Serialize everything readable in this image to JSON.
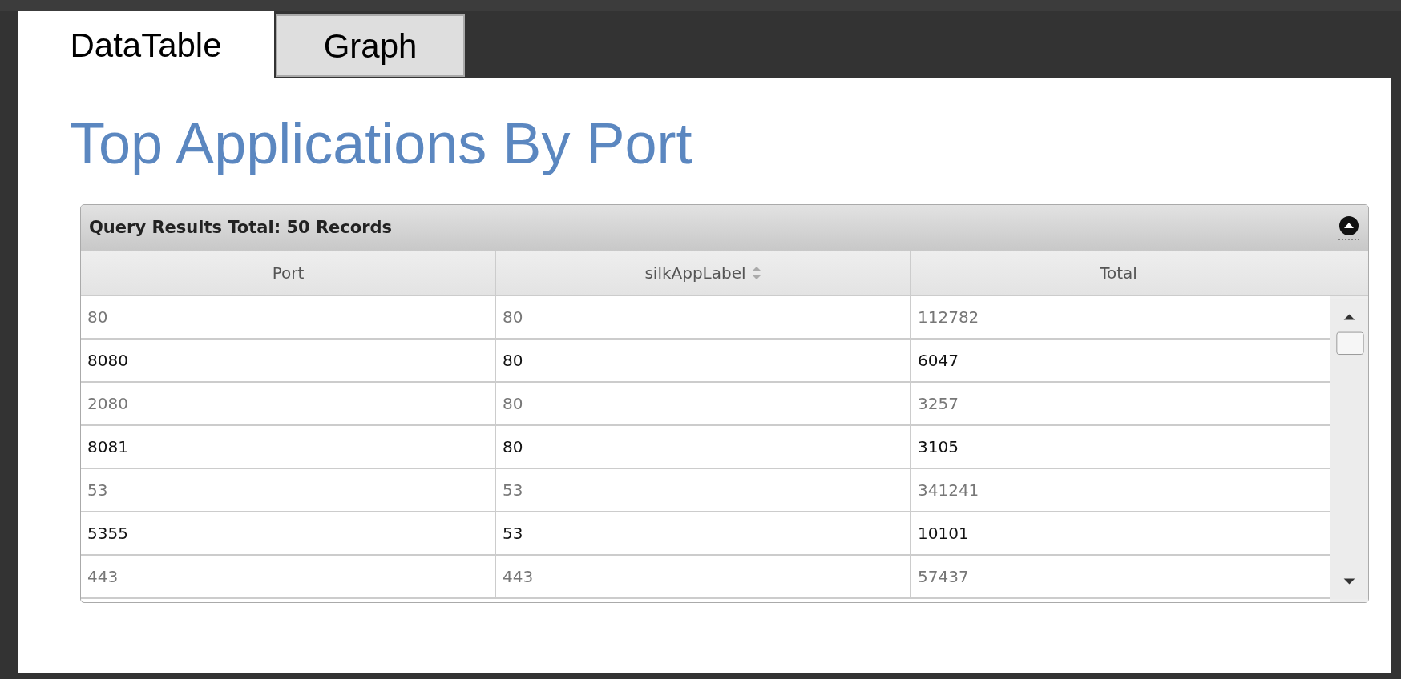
{
  "tabs": [
    {
      "label": "DataTable",
      "selected": true
    },
    {
      "label": "Graph",
      "selected": false
    }
  ],
  "title": "Top Applications By Port",
  "grid": {
    "caption": "Query Results Total: 50 Records",
    "columns": [
      {
        "label": "Port",
        "sortable": false
      },
      {
        "label": "silkAppLabel",
        "sortable": true
      },
      {
        "label": "Total",
        "sortable": false
      }
    ],
    "rows": [
      [
        "80",
        "80",
        "112782"
      ],
      [
        "8080",
        "80",
        "6047"
      ],
      [
        "2080",
        "80",
        "3257"
      ],
      [
        "8081",
        "80",
        "3105"
      ],
      [
        "53",
        "53",
        "341241"
      ],
      [
        "5355",
        "53",
        "10101"
      ],
      [
        "443",
        "443",
        "57437"
      ]
    ]
  }
}
